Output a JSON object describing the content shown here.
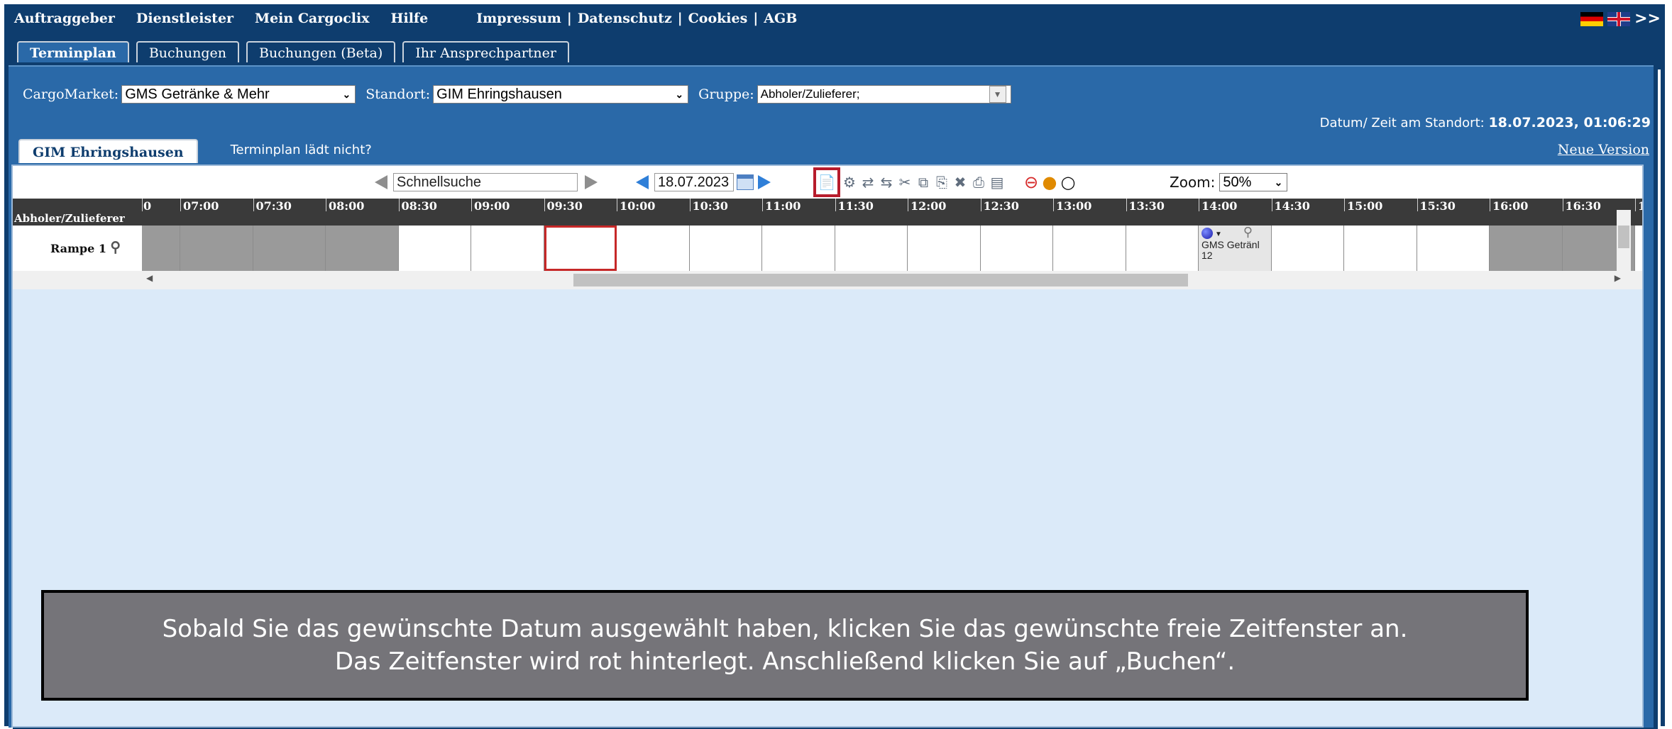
{
  "topnav": {
    "items": [
      "Auftraggeber",
      "Dienstleister",
      "Mein Cargoclix",
      "Hilfe"
    ],
    "legal": [
      "Impressum",
      "Datenschutz",
      "Cookies",
      "AGB"
    ],
    "more": ">>"
  },
  "tabs": [
    "Terminplan",
    "Buchungen",
    "Buchungen (Beta)",
    "Ihr Ansprechpartner"
  ],
  "filters": {
    "cargomarket_label": "CargoMarket:",
    "cargomarket_value": "GMS Getränke & Mehr",
    "standort_label": "Standort:",
    "standort_value": "GIM Ehringshausen",
    "gruppe_label": "Gruppe:",
    "gruppe_value": "Abholer/Zulieferer;"
  },
  "datetime": {
    "label": "Datum/ Zeit am Standort:",
    "value": "18.07.2023, 01:06:29"
  },
  "subtabs": {
    "active": "GIM Ehringshausen",
    "link": "Terminplan lädt nicht?",
    "neue_version": "Neue Version"
  },
  "toolbar": {
    "search_placeholder": "Schnellsuche",
    "date": "18.07.2023",
    "zoom_label": "Zoom:",
    "zoom_value": "50%"
  },
  "schedule": {
    "group_header": "Abholer/Zulieferer",
    "first_label": "0",
    "times": [
      "07:00",
      "07:30",
      "08:00",
      "08:30",
      "09:00",
      "09:30",
      "10:00",
      "10:30",
      "11:00",
      "11:30",
      "12:00",
      "12:30",
      "13:00",
      "13:30",
      "14:00",
      "14:30",
      "15:00",
      "15:30",
      "16:00",
      "16:30",
      "1"
    ],
    "rows": [
      {
        "name": "Rampe 1",
        "booking": {
          "time": "14:00",
          "title": "GMS Getränl",
          "count": "12"
        }
      }
    ]
  },
  "instruction": {
    "line1": "Sobald Sie das gewünschte Datum ausgewählt haben, klicken Sie das gewünschte freie Zeitfenster an.",
    "line2": "Das Zeitfenster wird rot hinterlegt. Anschließend klicken Sie auf „Buchen“."
  }
}
